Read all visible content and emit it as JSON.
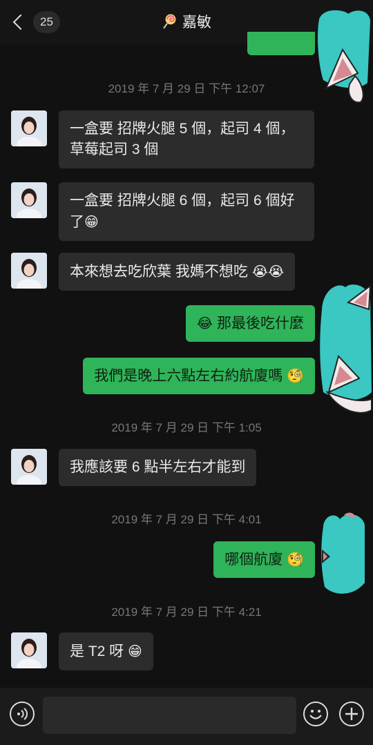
{
  "header": {
    "unread_count": "25",
    "title": "嘉敏",
    "title_icon": "lollipop-icon"
  },
  "messages": {
    "m0_partial": "",
    "ts1": "2019 年 7 月 29 日 下午 12:07",
    "m1": "一盒要 招牌火腿 5 個，起司 4 個，",
    "m1b": "草莓起司 3 個",
    "m2": "一盒要 招牌火腿 6 個，起司 6 個好",
    "m2b": "了",
    "m2_emoji": "😁",
    "m3": "本來想去吃欣葉 我媽不想吃",
    "m3_emoji": "😭😭",
    "m4_emoji": "😂",
    "m4": "那最後吃什麼",
    "m5": "我們是晚上六點左右約航廈嗎",
    "m5_emoji": "🧐",
    "ts2": "2019 年 7 月 29 日 下午 1:05",
    "m6": "我應該要 6 點半左右才能到",
    "ts3": "2019 年 7 月 29 日 下午 4:01",
    "m7": "哪個航廈",
    "m7_emoji": "🧐",
    "ts4": "2019 年 7 月 29 日 下午 4:21",
    "m8": "是 T2 呀",
    "m8_emoji": "😁"
  },
  "colors": {
    "background": "#111111",
    "incoming_bubble": "#2c2c2c",
    "outgoing_bubble": "#2fb45a",
    "sticker_teal": "#3bc7c2"
  },
  "input_bar": {
    "input_value": "",
    "voice_icon": "voice-icon",
    "emoji_icon": "emoji-icon",
    "add_icon": "plus-icon"
  }
}
